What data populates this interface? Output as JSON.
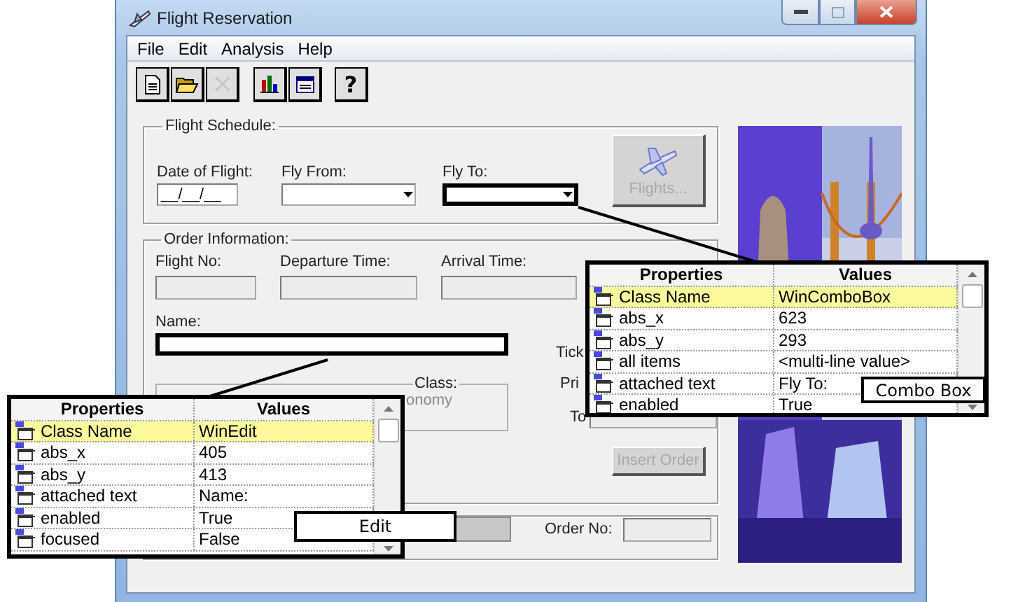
{
  "window": {
    "title": "Flight Reservation"
  },
  "menu": [
    {
      "label": "File"
    },
    {
      "label": "Edit"
    },
    {
      "label": "Analysis"
    },
    {
      "label": "Help"
    }
  ],
  "toolbar": [
    {
      "kind": "new",
      "disabled": false
    },
    {
      "kind": "open",
      "disabled": false
    },
    {
      "kind": "delete",
      "disabled": true
    },
    {
      "kind": "chart",
      "disabled": false
    },
    {
      "kind": "form",
      "disabled": false
    },
    {
      "kind": "help",
      "label": "?",
      "disabled": false
    }
  ],
  "flight_schedule": {
    "title": "Flight Schedule:",
    "fields": [
      {
        "label": "Date of Flight:",
        "kind": "date",
        "value": "__/__/__",
        "highlighted": false
      },
      {
        "label": "Fly From:",
        "kind": "combo",
        "highlighted": false
      },
      {
        "label": "Fly To:",
        "kind": "combo",
        "highlighted": true
      }
    ],
    "button": {
      "label": "Flights...",
      "disabled": true
    }
  },
  "order_information": {
    "title": "Order Information:",
    "fields": [
      {
        "label": "Flight No:",
        "disabled": true
      },
      {
        "label": "Departure Time:",
        "disabled": true
      },
      {
        "label": "Arrival Time:",
        "disabled": true
      }
    ],
    "name": {
      "label": "Name:",
      "highlighted": true
    },
    "class_group": {
      "title": "Class:",
      "option": "onomy"
    },
    "side_labels": [
      "Tick",
      "Pri",
      "To"
    ],
    "button": {
      "label": "Insert Order",
      "disabled": true
    }
  },
  "order_bar": {
    "label": "Order No:"
  },
  "callouts": [
    {
      "label": "Combo Box",
      "panel": {
        "columns": [
          "Properties",
          "Values"
        ],
        "rows": [
          {
            "property": "Class Name",
            "value": "WinComboBox",
            "selected": true
          },
          {
            "property": "abs_x",
            "value": "623",
            "selected": false
          },
          {
            "property": "abs_y",
            "value": "293",
            "selected": false
          },
          {
            "property": "all items",
            "value": "<multi-line value>",
            "selected": false
          },
          {
            "property": "attached text",
            "value": "Fly To:",
            "selected": false
          },
          {
            "property": "enabled",
            "value": "True",
            "selected": false
          }
        ]
      }
    },
    {
      "label": "Edit",
      "panel": {
        "columns": [
          "Properties",
          "Values"
        ],
        "rows": [
          {
            "property": "Class Name",
            "value": "WinEdit",
            "selected": true
          },
          {
            "property": "abs_x",
            "value": "405",
            "selected": false
          },
          {
            "property": "abs_y",
            "value": "413",
            "selected": false
          },
          {
            "property": "attached text",
            "value": "Name:",
            "selected": false
          },
          {
            "property": "enabled",
            "value": "True",
            "selected": false
          },
          {
            "property": "focused",
            "value": "False",
            "selected": false
          }
        ]
      }
    }
  ]
}
